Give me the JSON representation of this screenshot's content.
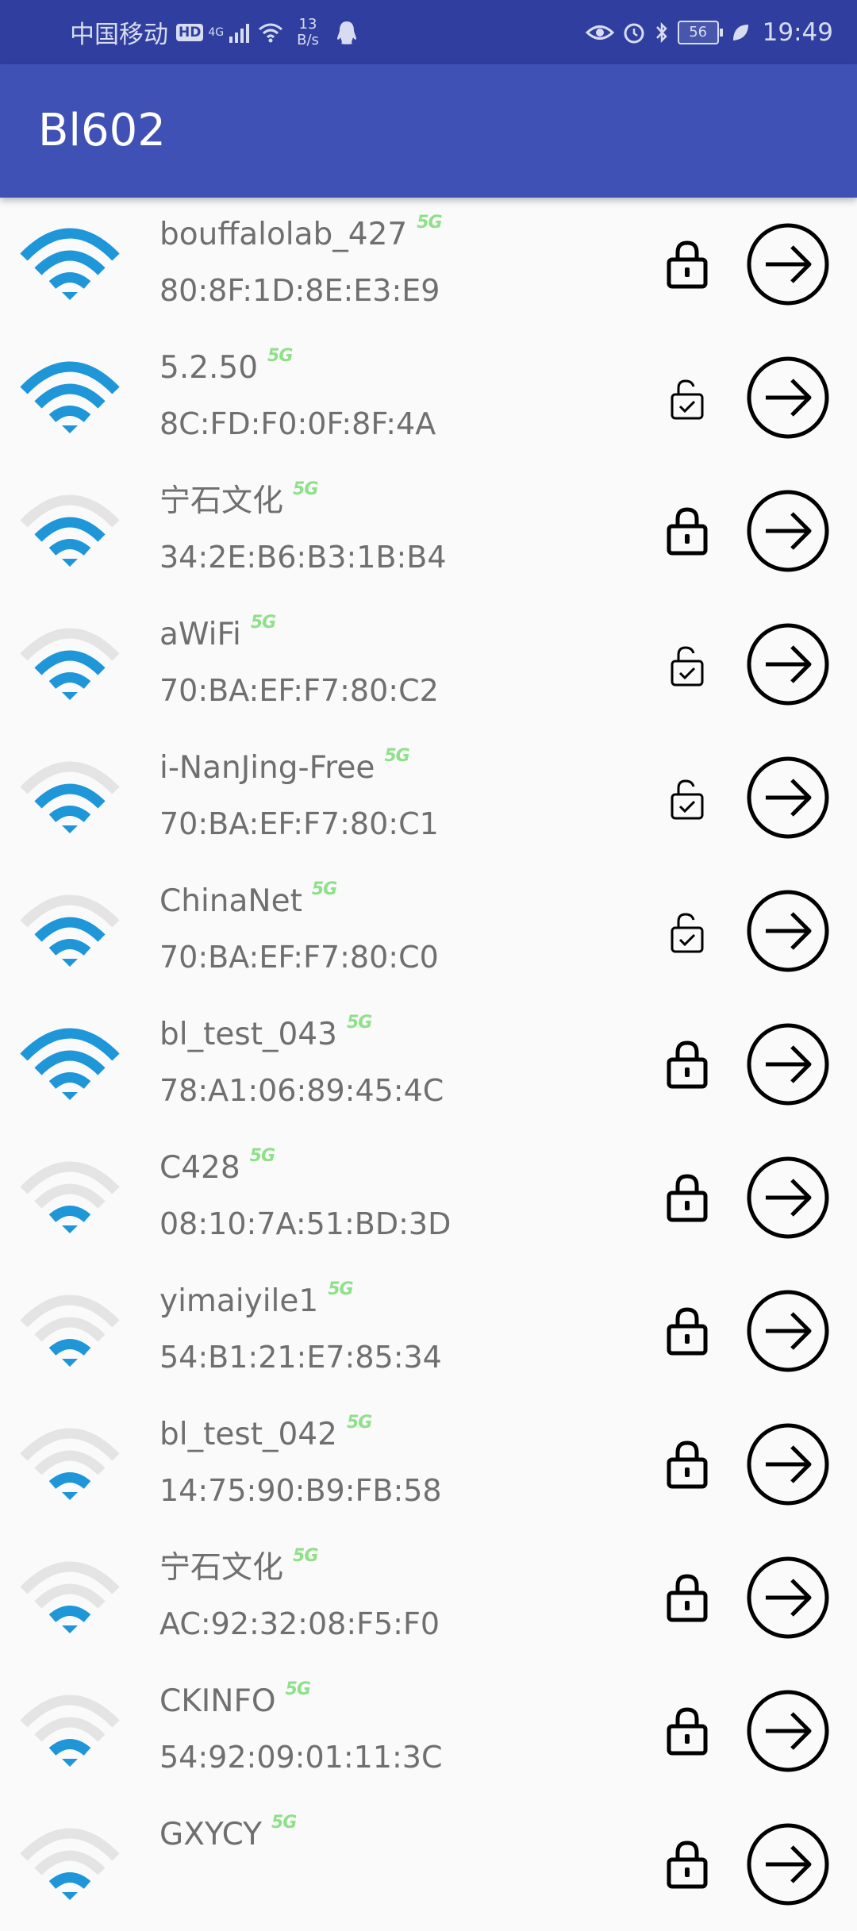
{
  "status_bar": {
    "carrier": "中国移动",
    "hd_label": "HD",
    "network_type": "4G",
    "speed_value": "13",
    "speed_unit": "B/s",
    "battery_level": "56",
    "time": "19:49"
  },
  "app_bar": {
    "title": "Bl602"
  },
  "band_label": "5G",
  "colors": {
    "status_bar_bg": "#303f9f",
    "app_bar_bg": "#3f51b5",
    "wifi_active": "#1e96d8",
    "wifi_inactive": "#e4e4e4",
    "band_badge": "#8fe08a",
    "text_secondary": "#6f6f6f"
  },
  "networks": [
    {
      "ssid": "bouffalolab_427",
      "bssid": "80:8F:1D:8E:E3:E9",
      "signal_bars": 4,
      "secured": true
    },
    {
      "ssid": "5.2.50",
      "bssid": "8C:FD:F0:0F:8F:4A",
      "signal_bars": 4,
      "secured": false
    },
    {
      "ssid": "宁石文化",
      "bssid": "34:2E:B6:B3:1B:B4",
      "signal_bars": 3,
      "secured": true
    },
    {
      "ssid": "aWiFi",
      "bssid": "70:BA:EF:F7:80:C2",
      "signal_bars": 3,
      "secured": false
    },
    {
      "ssid": "i-NanJing-Free",
      "bssid": "70:BA:EF:F7:80:C1",
      "signal_bars": 3,
      "secured": false
    },
    {
      "ssid": "ChinaNet",
      "bssid": "70:BA:EF:F7:80:C0",
      "signal_bars": 3,
      "secured": false
    },
    {
      "ssid": "bl_test_043",
      "bssid": "78:A1:06:89:45:4C",
      "signal_bars": 4,
      "secured": true
    },
    {
      "ssid": "C428",
      "bssid": "08:10:7A:51:BD:3D",
      "signal_bars": 2,
      "secured": true
    },
    {
      "ssid": "yimaiyile1",
      "bssid": "54:B1:21:E7:85:34",
      "signal_bars": 2,
      "secured": true
    },
    {
      "ssid": "bl_test_042",
      "bssid": "14:75:90:B9:FB:58",
      "signal_bars": 2,
      "secured": true
    },
    {
      "ssid": "宁石文化",
      "bssid": "AC:92:32:08:F5:F0",
      "signal_bars": 2,
      "secured": true
    },
    {
      "ssid": "CKINFO",
      "bssid": "54:92:09:01:11:3C",
      "signal_bars": 2,
      "secured": true
    },
    {
      "ssid": "GXYCY",
      "bssid": "",
      "signal_bars": 2,
      "secured": true
    }
  ]
}
